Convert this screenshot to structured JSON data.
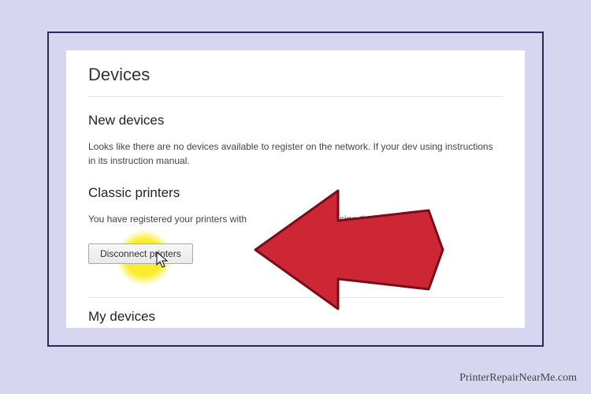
{
  "page": {
    "title": "Devices"
  },
  "sections": {
    "new_devices": {
      "header": "New devices",
      "body": "Looks like there are no devices available to register on the network. If your dev using instructions in its instruction manual."
    },
    "classic_printers": {
      "header": "Classic printers",
      "body": "You have registered your printers with                    ud Print using the account k",
      "button_label": "Disconnect printers"
    },
    "my_devices": {
      "header": "My devices"
    }
  },
  "footer": {
    "watermark": "PrinterRepairNearMe.com"
  },
  "overlay": {
    "highlight_color": "#f9ed2d",
    "arrow_color": "#cd2634",
    "arrow_stroke": "#7a0d18"
  }
}
